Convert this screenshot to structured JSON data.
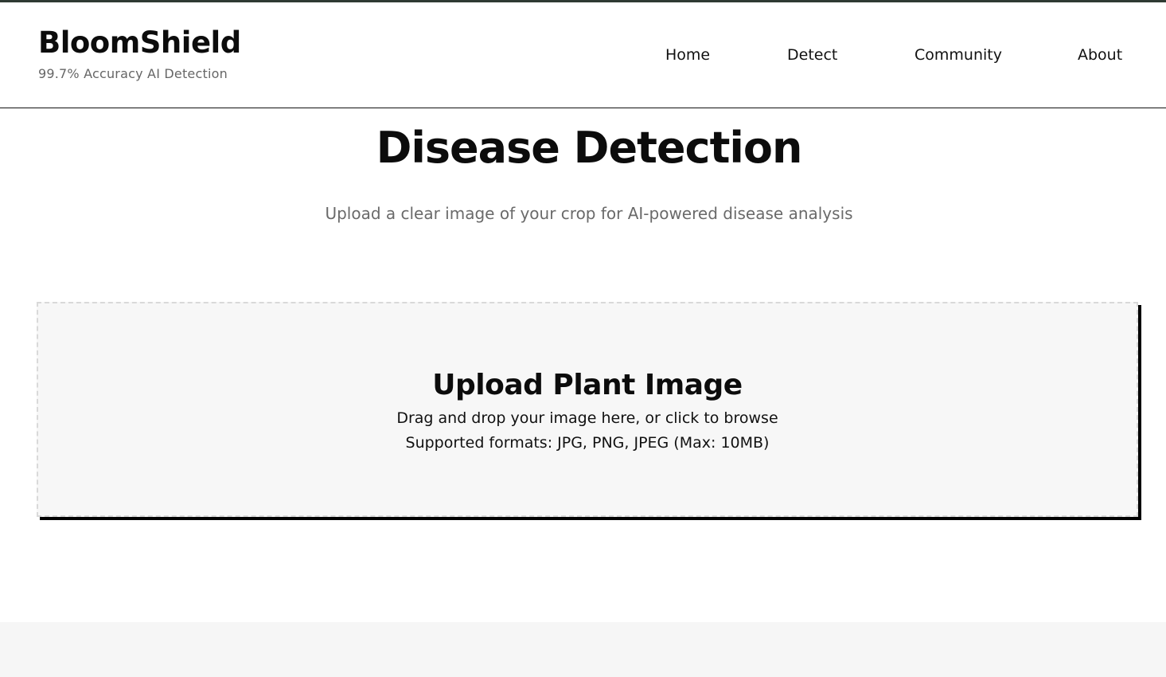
{
  "header": {
    "brand_title": "BloomShield",
    "brand_tagline": "99.7% Accuracy AI Detection",
    "nav": [
      {
        "label": "Home"
      },
      {
        "label": "Detect"
      },
      {
        "label": "Community"
      },
      {
        "label": "About"
      }
    ]
  },
  "main": {
    "title": "Disease Detection",
    "subtitle": "Upload a clear image of your crop for AI-powered disease analysis",
    "upload": {
      "title": "Upload Plant Image",
      "instructions": "Drag and drop your image here, or click to browse",
      "formats": "Supported formats: JPG, PNG, JPEG (Max: 10MB)"
    }
  },
  "colors": {
    "top_strip": "#2f3a33",
    "text_primary": "#0c0c0c",
    "text_muted": "#666666",
    "upload_background": "#f7f7f7",
    "upload_border": "#d9d9d9",
    "upload_shadow": "#000000",
    "footer_band": "#f6f6f6"
  }
}
